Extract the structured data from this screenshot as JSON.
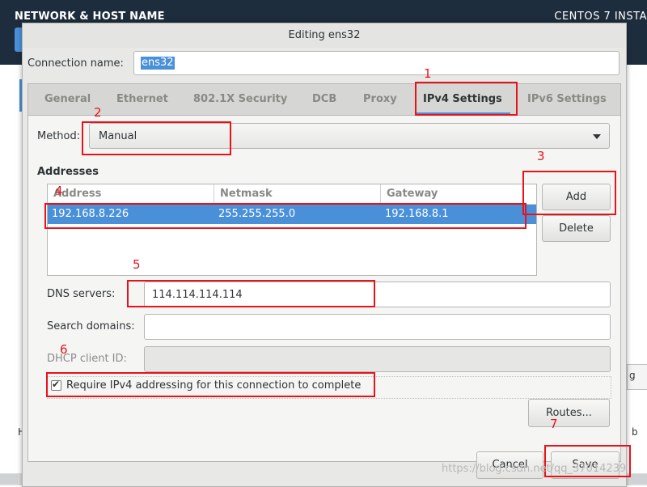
{
  "background": {
    "header_title": "NETWORK & HOST NAME",
    "header_right": "CENTOS 7 INSTA",
    "edge_glyph": "g",
    "left_glyph": "H",
    "right_glyph": "b"
  },
  "dialog": {
    "title": "Editing ens32",
    "connection_name_label": "Connection name:",
    "connection_name_value": "ens32"
  },
  "tabs": [
    {
      "label": "General"
    },
    {
      "label": "Ethernet"
    },
    {
      "label": "802.1X Security"
    },
    {
      "label": "DCB"
    },
    {
      "label": "Proxy"
    },
    {
      "label": "IPv4 Settings"
    },
    {
      "label": "IPv6 Settings"
    }
  ],
  "method": {
    "label": "Method:",
    "value": "Manual"
  },
  "addresses": {
    "label": "Addresses",
    "columns": [
      "Address",
      "Netmask",
      "Gateway"
    ],
    "rows": [
      [
        "192.168.8.226",
        "255.255.255.0",
        "192.168.8.1"
      ]
    ],
    "add_label": "Add",
    "delete_label": "Delete"
  },
  "fields": {
    "dns_label": "DNS servers:",
    "dns_value": "114.114.114.114",
    "search_label": "Search domains:",
    "search_value": "",
    "dhcp_label": "DHCP client ID:",
    "dhcp_value": ""
  },
  "require_ipv4_label": "Require IPv4 addressing for this connection to complete",
  "require_ipv4_checked": true,
  "routes_label": "Routes...",
  "cancel_label": "Cancel",
  "save_label": "Save",
  "annotations": [
    "1",
    "2",
    "3",
    "4",
    "5",
    "6",
    "7"
  ],
  "watermark": "https://blog.csdn.net/qq_37014239",
  "colors": {
    "accent": "#4a90d9",
    "annotation": "#e8121a",
    "header_bg": "#1e2d3d"
  }
}
